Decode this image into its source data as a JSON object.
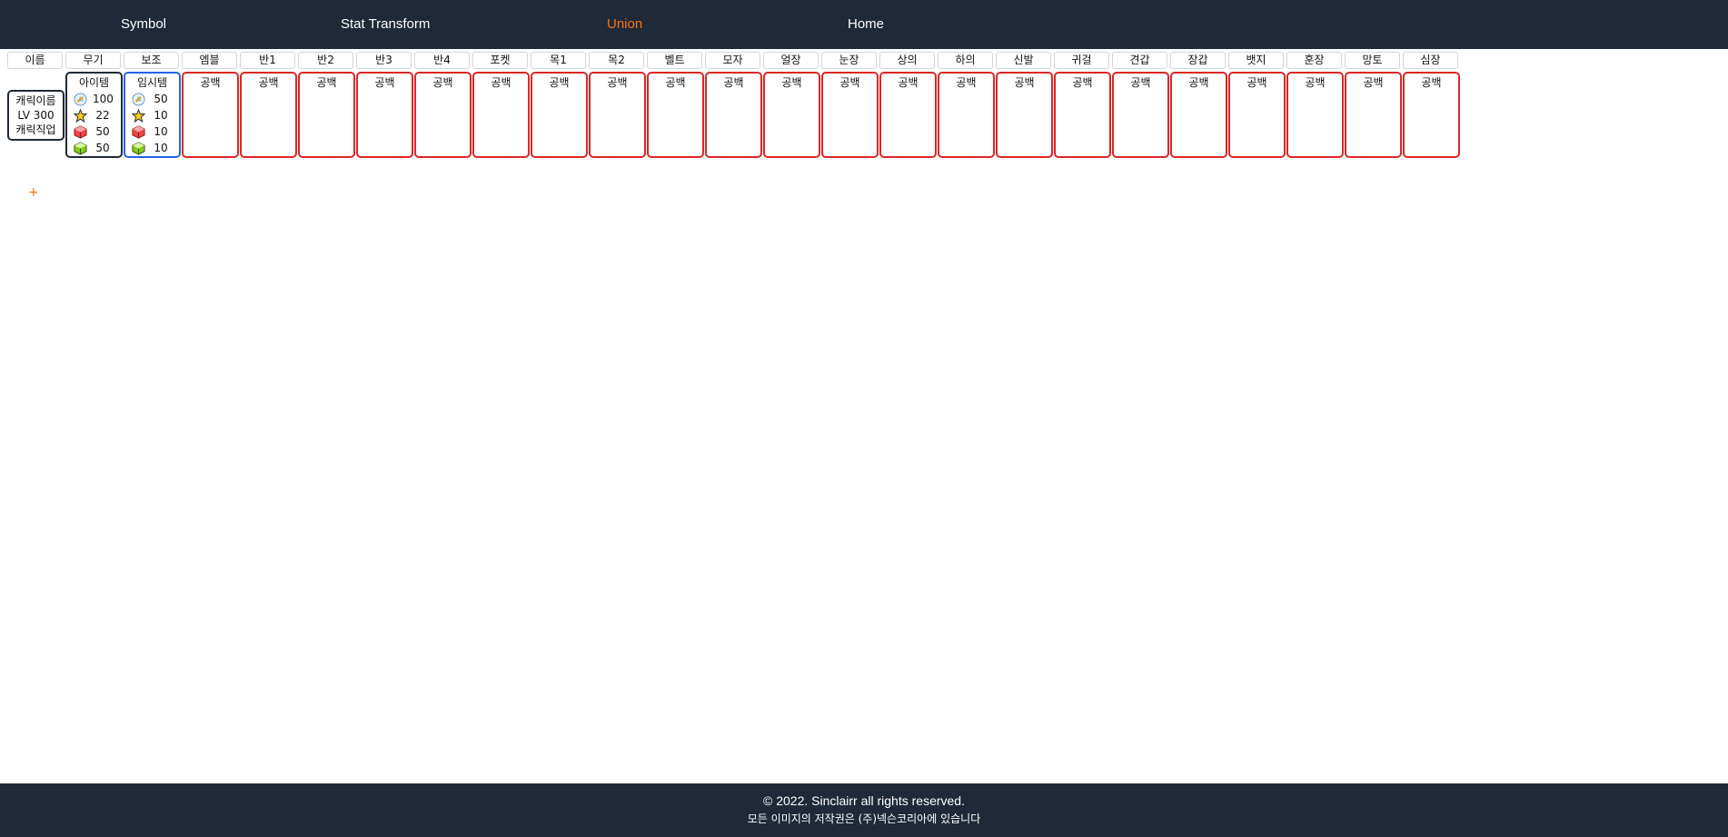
{
  "nav": {
    "items": [
      {
        "label": "Symbol"
      },
      {
        "label": "Stat Transform"
      },
      {
        "label": "Union",
        "active": true
      },
      {
        "label": "Home"
      }
    ],
    "active_color": "#f97316"
  },
  "columns": [
    "이름",
    "무기",
    "보조",
    "엠블",
    "반1",
    "반2",
    "반3",
    "반4",
    "포켓",
    "목1",
    "목2",
    "벨트",
    "모자",
    "얼장",
    "눈장",
    "상의",
    "하의",
    "신발",
    "귀걸",
    "견갑",
    "장갑",
    "뱃지",
    "훈장",
    "망토",
    "심장"
  ],
  "character": {
    "name": "캐릭이름",
    "level": "LV 300",
    "job": "캐릭직업"
  },
  "weapon": {
    "title": "아이템",
    "stats": [
      {
        "icon": "scroll-icon",
        "value": "100"
      },
      {
        "icon": "star-icon",
        "value": "22"
      },
      {
        "icon": "red-cube-icon",
        "value": "50"
      },
      {
        "icon": "green-cube-icon",
        "value": "50"
      }
    ]
  },
  "secondary": {
    "title": "임시템",
    "stats": [
      {
        "icon": "scroll-icon",
        "value": "50"
      },
      {
        "icon": "star-icon",
        "value": "10"
      },
      {
        "icon": "red-cube-icon",
        "value": "10"
      },
      {
        "icon": "green-cube-icon",
        "value": "10"
      }
    ]
  },
  "empty_slot_label": "공백",
  "add_label": "+",
  "footer": {
    "line1": "© 2022. Sinclairr all rights reserved.",
    "line2": "모든 이미지의 저작권은 (주)넥슨코리아에 있습니다"
  },
  "colors": {
    "nav_bg": "#1f2937",
    "slot_border_empty": "#dc2626",
    "slot_border_weapon": "#1f2937",
    "slot_border_secondary": "#2563eb"
  }
}
